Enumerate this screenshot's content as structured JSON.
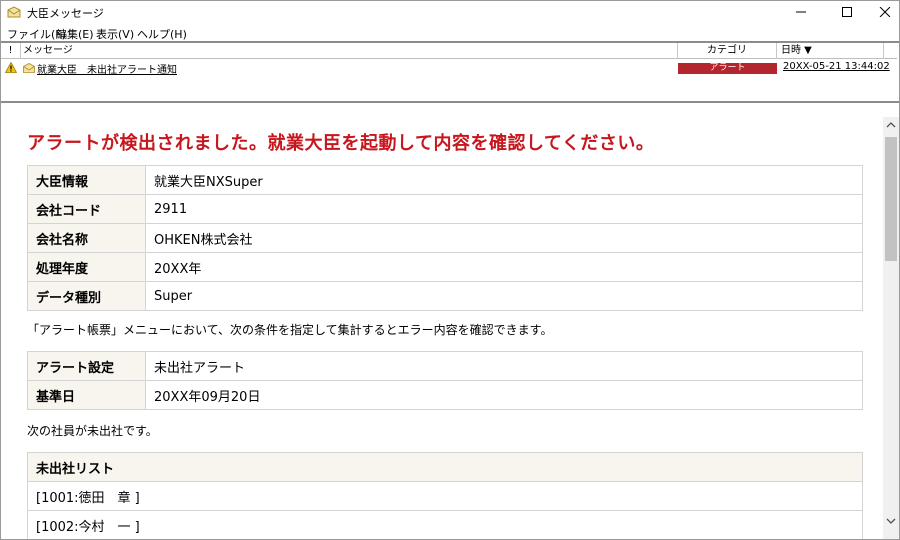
{
  "window": {
    "title": "大臣メッセージ",
    "icon": "envelope-icon"
  },
  "menu": {
    "items": [
      "ファイル(F)",
      "編集(E)",
      "表示(V)",
      "ヘルプ(H)"
    ]
  },
  "message_list": {
    "columns": {
      "priority": "!",
      "message": "メッセージ",
      "category": "カテゴリ",
      "date": "日時 ▼"
    },
    "rows": [
      {
        "title": "就業大臣　未出社アラート通知",
        "category": "アラート",
        "category_color": "#b3262e",
        "date": "20XX-05-21 13:44:02",
        "icon": "warning-icon"
      }
    ]
  },
  "detail": {
    "headline": "アラートが検出されました。就業大臣を起動して内容を確認してください。",
    "headline_color": "#c8161d",
    "info_table": [
      {
        "label": "大臣情報",
        "value": "就業大臣NXSuper"
      },
      {
        "label": "会社コード",
        "value": "2911"
      },
      {
        "label": "会社名称",
        "value": "OHKEN株式会社"
      },
      {
        "label": "処理年度",
        "value": "20XX年"
      },
      {
        "label": "データ種別",
        "value": "Super"
      }
    ],
    "note1": "「アラート帳票」メニューにおいて、次の条件を指定して集計するとエラー内容を確認できます。",
    "condition_table": [
      {
        "label": "アラート設定",
        "value": "未出社アラート"
      },
      {
        "label": "基準日",
        "value": "20XX年09月20日"
      }
    ],
    "note2": "次の社員が未出社です。",
    "absent_list": {
      "header": "未出社リスト",
      "items": [
        "[1001:徳田　章 ]",
        "[1002:今村　一 ]"
      ]
    }
  }
}
